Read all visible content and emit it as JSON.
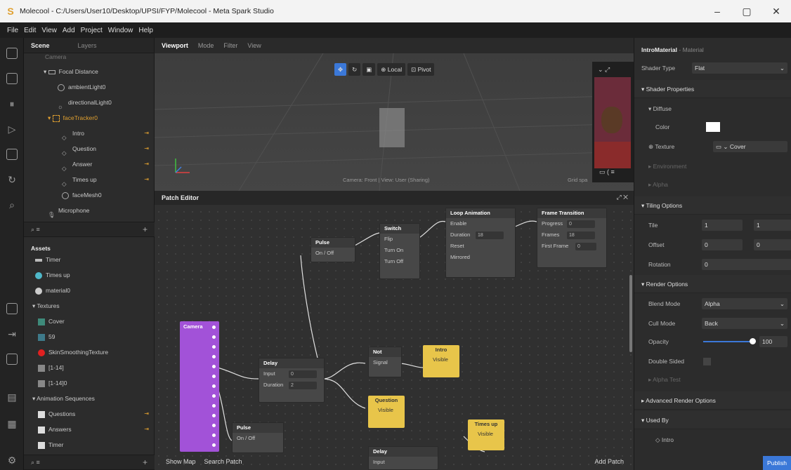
{
  "window": {
    "title": "Molecool - C:/Users/User10/Desktop/UPSI/FYP/Molecool - Meta Spark Studio",
    "minimize": "–",
    "restore": "▢",
    "close": "✕"
  },
  "menu": [
    "File",
    "Edit",
    "View",
    "Add",
    "Project",
    "Window",
    "Help"
  ],
  "scene": {
    "tabs": {
      "scene": "Scene",
      "layers": "Layers"
    },
    "items": {
      "camera": "Camera",
      "focal": "Focal Distance",
      "ambient": "ambientLight0",
      "directional": "directionalLight0",
      "facetracker": "faceTracker0",
      "intro": "Intro",
      "question": "Question",
      "answer": "Answer",
      "timesup": "Times up",
      "facemesh": "faceMesh0",
      "microphone": "Microphone"
    }
  },
  "assets": {
    "title": "Assets",
    "timer": "Timer",
    "timesup": "Times up",
    "material": "material0",
    "textures": "Textures",
    "cover": "Cover",
    "n59": "59",
    "skin": "SkinSmoothingTexture",
    "t114": "[1-14]",
    "t1140": "[1-14]0",
    "animseq": "Animation Sequences",
    "questions": "Questions",
    "answers": "Answers",
    "timer2": "Timer"
  },
  "viewport": {
    "tabs": {
      "viewport": "Viewport",
      "mode": "Mode",
      "filter": "Filter",
      "view": "View"
    },
    "local": "Local",
    "pivot": "Pivot",
    "status": "Camera: Front | View: User (Sharing)",
    "grid": "Grid spa"
  },
  "patch": {
    "title": "Patch Editor",
    "show_map": "Show Map",
    "search": "Search Patch",
    "add": "Add Patch",
    "pulse": {
      "title": "Pulse",
      "onoff": "On / Off"
    },
    "switch": {
      "title": "Switch",
      "flip": "Flip",
      "on": "Turn On",
      "off": "Turn Off"
    },
    "loop": {
      "title": "Loop Animation",
      "enable": "Enable",
      "duration": "Duration",
      "duration_val": "18",
      "reset": "Reset",
      "mirrored": "Mirrored"
    },
    "frame": {
      "title": "Frame Transition",
      "progress": "Progress",
      "progress_val": "0",
      "frames": "Frames",
      "frames_val": "18",
      "first": "First Frame",
      "first_val": "0"
    },
    "camera": {
      "title": "Camera"
    },
    "delay": {
      "title": "Delay",
      "input": "Input",
      "input_val": "0",
      "duration": "Duration",
      "duration_val": "2"
    },
    "not": {
      "title": "Not",
      "signal": "Signal"
    },
    "intro": {
      "title": "Intro",
      "visible": "Visible"
    },
    "question": {
      "title": "Question",
      "visible": "Visible"
    },
    "pulse2": {
      "title": "Pulse",
      "onoff": "On / Off"
    },
    "timesup": {
      "title": "Times up",
      "visible": "Visible"
    },
    "delay2": {
      "title": "Delay",
      "input": "Input"
    }
  },
  "props": {
    "name": "IntroMaterial",
    "kind": "- Material",
    "shader_type": "Shader Type",
    "shader_val": "Flat",
    "shader_props": "Shader Properties",
    "diffuse": "Diffuse",
    "color": "Color",
    "texture": "Texture",
    "texture_val": "Cover",
    "environment": "Environment",
    "alpha": "Alpha",
    "tiling": "Tiling Options",
    "tile": "Tile",
    "tile1": "1",
    "tile2": "1",
    "offset": "Offset",
    "offset1": "0",
    "offset2": "0",
    "rotation": "Rotation",
    "rotation_val": "0",
    "render": "Render Options",
    "blend": "Blend Mode",
    "blend_val": "Alpha",
    "cull": "Cull Mode",
    "cull_val": "Back",
    "opacity": "Opacity",
    "opacity_val": "100",
    "double": "Double Sided",
    "alpha_test": "Alpha Test",
    "advanced": "Advanced Render Options",
    "used_by": "Used By",
    "used_item": "Intro",
    "publish": "Publish"
  }
}
